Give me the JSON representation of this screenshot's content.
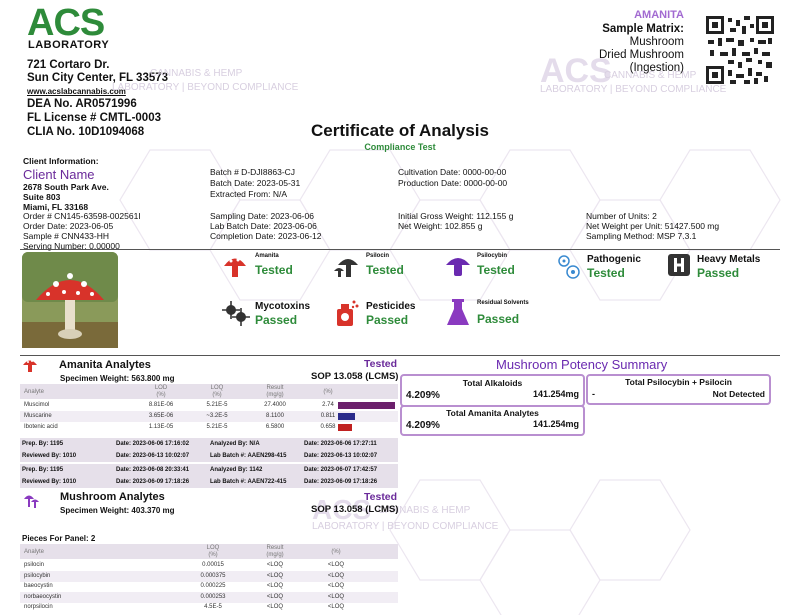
{
  "lab": {
    "logo_text": "ACS",
    "logo_sub": "LABORATORY",
    "address1": "721 Cortaro Dr.",
    "address2": "Sun City Center, FL 33573",
    "website": "www.acslabcannabis.com",
    "dea": "DEA No. AR0571996",
    "fl_license": "FL License # CMTL-0003",
    "clia": "CLIA No. 10D1094068"
  },
  "watermark": {
    "acs": "ACS",
    "line1": "CANNABIS & HEMP",
    "line2": "LABORATORY | BEYOND COMPLIANCE"
  },
  "sample": {
    "product": "AMANITA",
    "matrix_label": "Sample Matrix:",
    "matrix1": "Mushroom",
    "matrix2": "Dried Mushroom",
    "matrix3": "(Ingestion)"
  },
  "title": "Certificate of Analysis",
  "subtitle": "Compliance Test",
  "client": {
    "label": "Client Information:",
    "name": "Client Name",
    "addr1": "2678 South Park Ave.",
    "addr2": "Suite 803",
    "addr3": "Miami, FL 33168"
  },
  "info": {
    "batch": "Batch # D-DJI8863-CJ",
    "batch_date": "Batch Date:  2023-05-31",
    "extracted_from": "Extracted From: N/A",
    "cultivation_date": "Cultivation Date:  0000-00-00",
    "production_date": "Production Date:  0000-00-00",
    "order": "Order # CN145-63598-002561I",
    "order_date": "Order Date:  2023-06-05",
    "sample_no": "Sample # CNN433-HH",
    "serving": "Serving Number:  0.00000",
    "sampling_date": "Sampling Date:  2023-06-06",
    "lab_batch_date": "Lab Batch Date:  2023-06-06",
    "completion_date": "Completion Date:  2023-06-12",
    "gross_weight": "Initial Gross Weight:  112.155 g",
    "net_weight": "Net Weight:  102.855 g",
    "units": "Number of Units:  2",
    "net_per_unit": "Net Weight per Unit:  51427.500 mg",
    "sampling_method": "Sampling Method:  MSP 7.3.1"
  },
  "tests": [
    {
      "name": "Amanita",
      "status": "Tested",
      "icon": "amanita-icon"
    },
    {
      "name": "Psilocin",
      "status": "Tested",
      "icon": "mushroom-icon"
    },
    {
      "name": "Psilocybin",
      "status": "Tested",
      "icon": "mushroom-cap-icon"
    },
    {
      "name": "Pathogenic",
      "status": "Tested",
      "icon": "pathogen-icon"
    },
    {
      "name": "Heavy Metals",
      "status": "Passed",
      "icon": "heavy-metals-icon"
    },
    {
      "name": "Mycotoxins",
      "status": "Passed",
      "icon": "mycotoxins-icon"
    },
    {
      "name": "Pesticides",
      "status": "Passed",
      "icon": "pesticides-icon"
    },
    {
      "name": "Residual Solvents",
      "status": "Passed",
      "icon": "residual-solvents-icon"
    }
  ],
  "amanita": {
    "title": "Amanita Analytes",
    "status": "Tested",
    "weight": "Specimen Weight: 563.800 mg",
    "sop": "SOP 13.058 (LCMS)",
    "headers": [
      "Analyte",
      "LOD\n(%)",
      "LOQ\n(%)",
      "Result\n(mg/g)",
      "(%)"
    ],
    "rows": [
      {
        "analyte": "Muscimol",
        "lod": "8.81E-06",
        "loq": "5.21E-5",
        "result": "27.4000",
        "pct": "2.74",
        "bar": 1.0,
        "color": "#6b1f6b"
      },
      {
        "analyte": "Muscarine",
        "lod": "3.65E-06",
        "loq": "~3.2E-5",
        "result": "8.1100",
        "pct": "0.811",
        "bar": 0.296,
        "color": "#2a2a8a"
      },
      {
        "analyte": "Ibotenic acid",
        "lod": "1.13E-05",
        "loq": "5.21E-5",
        "result": "6.5800",
        "pct": "0.658",
        "bar": 0.24,
        "color": "#c02020"
      }
    ]
  },
  "prep1": {
    "prep_by": "Prep. By: 1195",
    "date1": "Date: 2023-06-06 17:16:02",
    "analyzed_by": "Analyzed By: N/A",
    "date2": "Date: 2023-06-06 17:27:11",
    "reviewed_by": "Reviewed By: 1010",
    "date3": "Date: 2023-06-13 10:02:07",
    "lab_batch": "Lab Batch #: AAEN298-415",
    "date4": "Date: 2023-06-13 10:02:07"
  },
  "prep2": {
    "prep_by": "Prep. By: 1195",
    "date1": "Date: 2023-06-08 20:33:41",
    "analyzed_by": "Analyzed By: 1142",
    "date2": "Date: 2023-06-07 17:42:57",
    "reviewed_by": "Reviewed By: 1010",
    "date3": "Date: 2023-06-09 17:18:26",
    "lab_batch": "Lab Batch #: AAEN722-415",
    "date4": "Date: 2023-06-09 17:18:26"
  },
  "potency": {
    "title": "Mushroom Potency Summary",
    "total_alkaloids_label": "Total Alkaloids",
    "total_alkaloids_pct": "4.209%",
    "total_alkaloids_mg": "141.254mg",
    "total_amanita_label": "Total Amanita Analytes",
    "total_amanita_pct": "4.209%",
    "total_amanita_mg": "141.254mg",
    "psilo_label": "Total Psilocybin + Psilocin",
    "psilo_pct": "-",
    "psilo_value": "Not Detected"
  },
  "mushroom": {
    "title": "Mushroom Analytes",
    "status": "Tested",
    "weight": "Specimen Weight: 403.370 mg",
    "sop": "SOP 13.058 (LCMS)",
    "pieces": "Pieces For Panel: 2",
    "headers": [
      "Analyte",
      "LOQ\n(%)",
      "Result\n(mg/g)",
      "(%)"
    ],
    "rows": [
      {
        "analyte": "psilocin",
        "loq": "0.00015",
        "result": "<LOQ",
        "pct": "<LOQ"
      },
      {
        "analyte": "psilocybin",
        "loq": "0.000375",
        "result": "<LOQ",
        "pct": "<LOQ"
      },
      {
        "analyte": "baeocystin",
        "loq": "0.000225",
        "result": "<LOQ",
        "pct": "<LOQ"
      },
      {
        "analyte": "norbaeocystin",
        "loq": "0.000253",
        "result": "<LOQ",
        "pct": "<LOQ"
      },
      {
        "analyte": "norpsilocin",
        "loq": "4.5E-5",
        "result": "<LOQ",
        "pct": "<LOQ"
      }
    ]
  }
}
